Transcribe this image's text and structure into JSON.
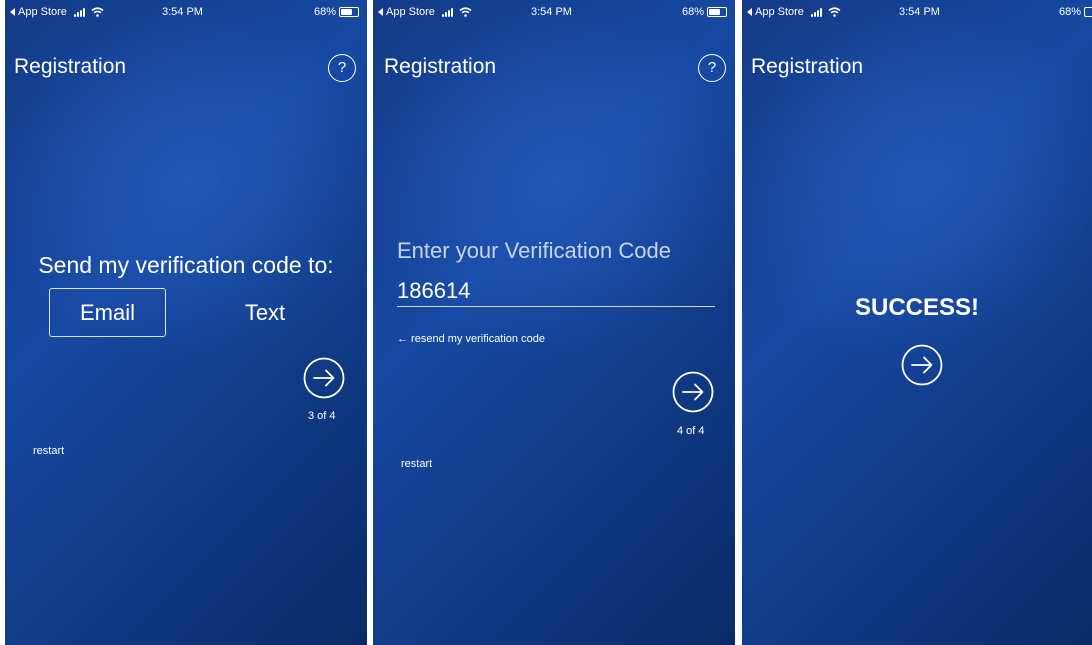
{
  "status_bar": {
    "back_label": "App Store",
    "time": "3:54 PM",
    "battery": "68%"
  },
  "screens": [
    {
      "title": "Registration",
      "help_label": "?",
      "prompt": "Send my verification code to:",
      "options": [
        {
          "label": "Email",
          "selected": true
        },
        {
          "label": "Text",
          "selected": false
        }
      ],
      "step": "3 of 4",
      "restart": "restart"
    },
    {
      "title": "Registration",
      "help_label": "?",
      "code_label": "Enter your Verification Code",
      "code_value": "186614",
      "resend": "← resend my verification code",
      "step": "4 of 4",
      "restart": "restart"
    },
    {
      "title": "Registration",
      "message": "SUCCESS!"
    }
  ],
  "colors": {
    "background_top": "#1649a3",
    "background_bottom": "#0b2a67",
    "text": "#ffffff",
    "muted_label": "#c9d3ee"
  },
  "icons": {
    "back": "triangle-left-icon",
    "signal": "cellular-signal-icon",
    "wifi": "wifi-icon",
    "battery": "battery-icon",
    "help": "question-circle-icon",
    "next": "arrow-right-circle-icon"
  }
}
